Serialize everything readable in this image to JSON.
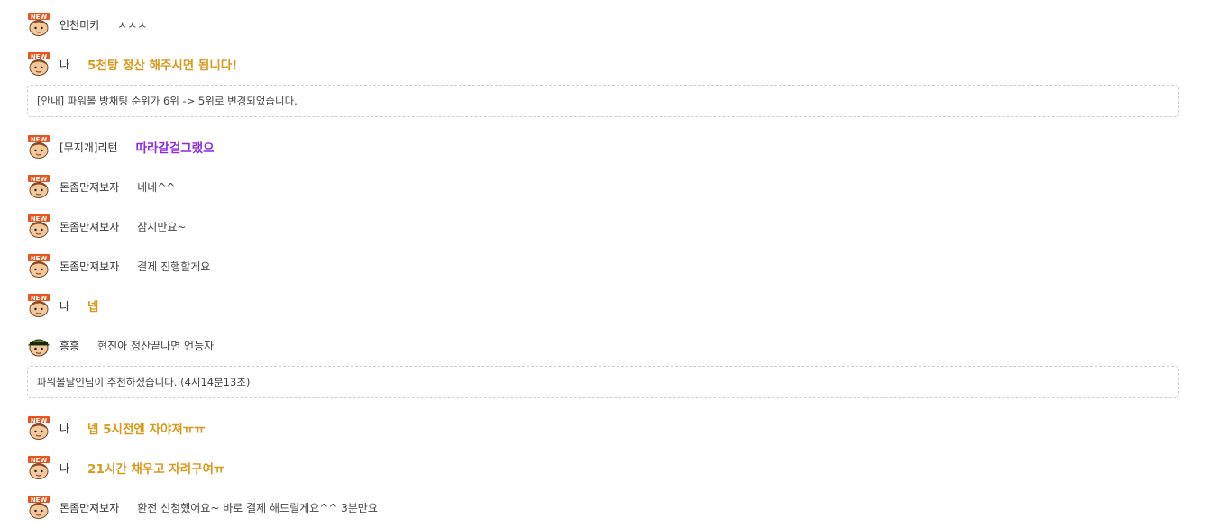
{
  "messages": [
    {
      "nick": "인천미키",
      "text": "ㅅㅅㅅ"
    },
    {
      "nick": "나",
      "text": "5천탕 정산 해주시면 됩니다!"
    },
    {
      "notice": "[안내] 파워볼 방채팅 순위가 6위 -> 5위로 변경되었습니다."
    },
    {
      "nick": "[무지개]리턴",
      "text": "따라갈걸그랬으"
    },
    {
      "nick": "돈좀만져보자",
      "text": "네네^^"
    },
    {
      "nick": "돈좀만져보자",
      "text": "잠시만요~"
    },
    {
      "nick": "돈좀만져보자",
      "text": "결제 진행할게요"
    },
    {
      "nick": "나",
      "text": "넵"
    },
    {
      "nick": "흥흥",
      "text": "현진아 정산끝나면 언능자"
    },
    {
      "notice": "파워볼달인님이 추천하셨습니다. (4시14분13초)"
    },
    {
      "nick": "나",
      "text": "넵 5시전엔 자야져ㅠㅠ"
    },
    {
      "nick": "나",
      "text": "21시간 채우고 자려구여ㅠ"
    },
    {
      "nick": "돈좀만져보자",
      "text": "환전 신청했어요~ 바로 결제 해드릴게요^^ 3분만요"
    }
  ],
  "badge_text": "NEW",
  "colors": {
    "mine_text": "#d89a1e",
    "rainbow_text": "#8a2be2",
    "notice_border": "#cfcfcf"
  }
}
